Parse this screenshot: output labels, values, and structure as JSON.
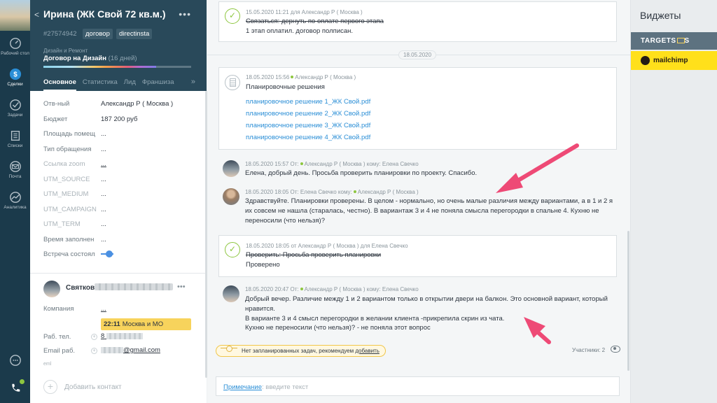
{
  "nav": {
    "items": [
      {
        "label": "Рабочий стол",
        "icon": "dashboard-icon"
      },
      {
        "label": "Сделки",
        "icon": "deals-icon"
      },
      {
        "label": "Задачи",
        "icon": "tasks-icon"
      },
      {
        "label": "Списки",
        "icon": "lists-icon"
      },
      {
        "label": "Почта",
        "icon": "mail-icon"
      },
      {
        "label": "Аналитика",
        "icon": "analytics-icon"
      }
    ]
  },
  "lead": {
    "title": "Ирина (ЖК Свой 72 кв.м.)",
    "id": "#27574942",
    "tags": [
      "договор",
      "directinsta"
    ],
    "pipeline_label": "Дизайн и Ремонт",
    "stage": "Договор на Дизайн",
    "stage_days": "(16 дней)",
    "tabs": [
      "Основное",
      "Статистика",
      "Лид",
      "Франшиза"
    ],
    "more": "»",
    "fields": [
      {
        "label": "Отв-ный",
        "value": "Александр Р ( Москва )"
      },
      {
        "label": "Бюджет",
        "value": "187 200 руб"
      },
      {
        "label": "Площадь помещ",
        "value": "..."
      },
      {
        "label": "Тип обращения",
        "value": "..."
      },
      {
        "label": "Ссылка zoom",
        "value": "..."
      },
      {
        "label": "UTM_SOURCE",
        "value": "..."
      },
      {
        "label": "UTM_MEDIUM",
        "value": "..."
      },
      {
        "label": "UTM_CAMPAIGN",
        "value": "..."
      },
      {
        "label": "UTM_TERM",
        "value": "..."
      },
      {
        "label": "Время заполнен",
        "value": "..."
      },
      {
        "label": "Встреча состоял",
        "value": ""
      }
    ]
  },
  "contact": {
    "name": "Святков",
    "company_label": "Компания",
    "company_value": "...",
    "time_badge_time": "22:11",
    "time_badge_zone": "Москва и МО",
    "phone_label": "Раб. тел.",
    "phone_prefix": "8",
    "email_label": "Email раб.",
    "email_suffix": "@gmail.com",
    "email_sub": "eml",
    "add_contact": "Добавить контакт"
  },
  "feed": {
    "date_sep": "18.05.2020",
    "task1": {
      "meta": "15.05.2020 11:21  для Александр Р ( Москва )",
      "title": "Связаться: дернуть по оплате первого этапа",
      "result": "1 этап оплатил. договор полписан."
    },
    "note": {
      "meta_time": "18.05.2020 15:56",
      "meta_author": "Александр Р ( Москва )",
      "title": "Планировочные решения",
      "files": [
        "планировочное решение 1_ЖК Свой.pdf",
        "планировочное решение 2_ЖК Свой.pdf",
        "планировочное решение 3_ЖК Свой.pdf",
        "планировочное решение 4_ЖК Свой.pdf"
      ]
    },
    "msg1": {
      "meta_pre": "18.05.2020 15:57 От:",
      "meta_post": "Александр Р ( Москва ) кому: Елена Свечко",
      "lines": [
        "Елена, добрый день. Просьба проверить планировки по проекту. Спасибо."
      ]
    },
    "msg2": {
      "meta_pre": "18.05.2020 18:05 От: Елена Свечко кому:",
      "meta_post": "Александр Р ( Москва )",
      "lines": [
        "Здравствуйте. Планировки проверены. В целом - нормально, но очень малые различия между вариантами, а в 1 и 2 я",
        "их совсем не нашла (старалась, честно). В вариантаж 3 и 4 не поняла смысла перегородки в спальне 4. Кухню не",
        "переносили (что нельзя)?"
      ]
    },
    "task2": {
      "meta": "18.05.2020 18:05  от Александр Р ( Москва ) для Елена Свечко",
      "title": "Проверить: Просьба проверить планировки",
      "result": "Проверено"
    },
    "msg3": {
      "meta_pre": "18.05.2020 20:47 От:",
      "meta_post": "Александр Р ( Москва ) кому: Елена Свечко",
      "lines": [
        "Добрый вечер. Различие между 1 и 2 вариантом только в открытии двери на балкон. Это основной вариант, который",
        "нравится.",
        "В варианте 3 и 4 смысл перегородки в желании клиента -прикрепила скрин из чата.",
        "Кухню не переносили (что нельзя)? - не поняла этот вопрос"
      ]
    },
    "no_tasks_text": "Нет запланированных задач, рекомендуем",
    "no_tasks_link": "добавить",
    "participants": "Участники: 2"
  },
  "compose": {
    "kind": "Примечание",
    "placeholder": ": введите текст"
  },
  "widgets": {
    "title": "Виджеты",
    "targets": "TARGETS",
    "targets_suffix": "S",
    "mailchimp": "mailchimp"
  },
  "colors": {
    "nav_bg": "#1b3a4b",
    "lead_header_bg": "#29495a",
    "link": "#2a8ed6",
    "check_green": "#8dc63f",
    "arrow_pink": "#ee4a76",
    "badge_yellow": "#f7d35c",
    "mailchimp_yellow": "#ffe01b"
  }
}
